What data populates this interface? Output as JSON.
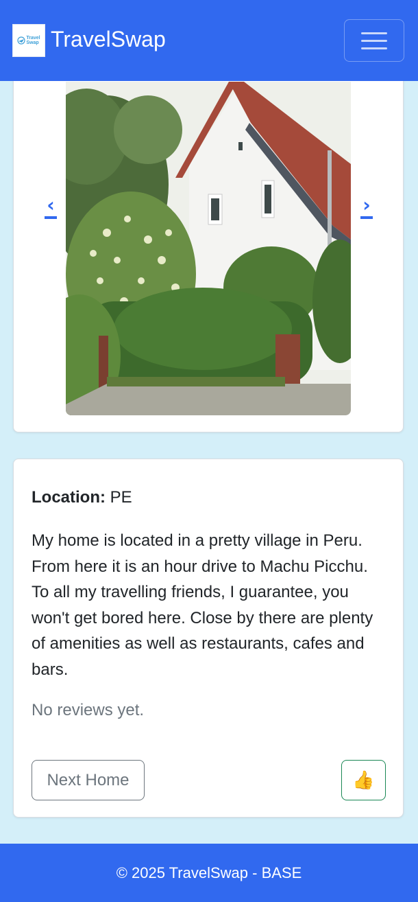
{
  "navbar": {
    "brand_name": "TravelSwap",
    "logo_text_line1": "Travel",
    "logo_text_line2": "Swap",
    "toggle_icon": "hamburger-menu-icon",
    "color": "#3169ef"
  },
  "gallery": {
    "prev_label": "‹",
    "next_label": "›",
    "photo_subject": "white-house-with-red-roof-and-garden"
  },
  "listing": {
    "location_label": "Location:",
    "location_value": "PE",
    "description": "My home is located in a pretty village in Peru. From here it is an hour drive to Machu Picchu. To all my travelling friends, I guarantee, you won't get bored here. Close by there are plenty of amenities as well as restaurants, cafes and bars.",
    "reviews_text": "No reviews yet.",
    "next_button": "Next Home",
    "like_button": "👍"
  },
  "footer": {
    "text": "© 2025 TravelSwap - BASE"
  },
  "colors": {
    "primary": "#3169ef",
    "background": "#d4eff9",
    "success_border": "#198754",
    "secondary_text": "#6c757d"
  }
}
